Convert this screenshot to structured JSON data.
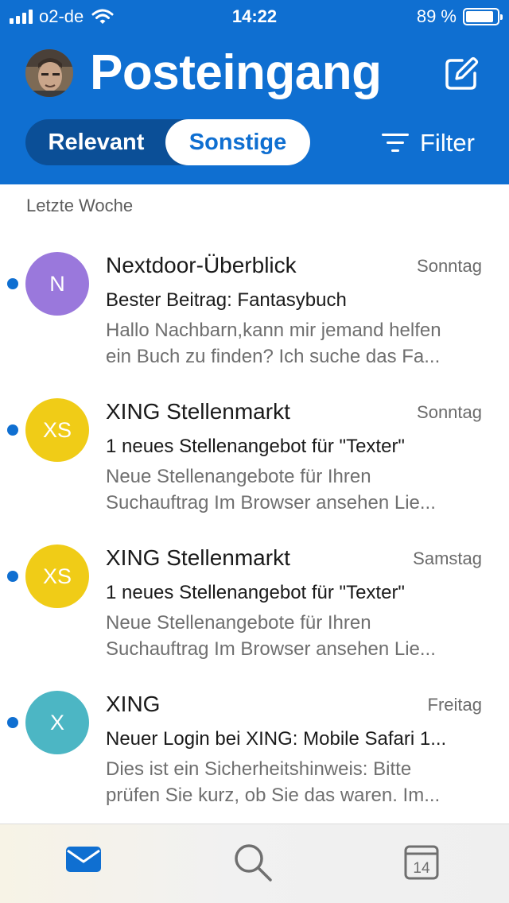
{
  "status_bar": {
    "carrier": "o2-de",
    "time": "14:22",
    "battery_percent": "89 %",
    "battery_level": 0.89
  },
  "header": {
    "title": "Posteingang",
    "compose_icon": "compose-icon",
    "avatar": "user-avatar-photo"
  },
  "tabs": {
    "relevant": "Relevant",
    "sonstige": "Sonstige",
    "selected": "Sonstige",
    "filter_label": "Filter"
  },
  "section_label": "Letzte Woche",
  "messages": [
    {
      "initials": "N",
      "avatar_color": "#9a78dc",
      "sender": "Nextdoor-Überblick",
      "date": "Sonntag",
      "subject": "Bester Beitrag: Fantasybuch",
      "preview_line1": "Hallo Nachbarn,kann mir jemand helfen",
      "preview_line2": "ein Buch zu finden? Ich suche das Fa...",
      "unread": true
    },
    {
      "initials": "XS",
      "avatar_color": "#f0cc17",
      "sender": "XING Stellenmarkt",
      "date": "Sonntag",
      "subject": "1 neues Stellenangebot für \"Texter\"",
      "preview_line1": "Neue Stellenangebote für Ihren",
      "preview_line2": "Suchauftrag Im Browser ansehen Lie...",
      "unread": true
    },
    {
      "initials": "XS",
      "avatar_color": "#f0cc17",
      "sender": "XING Stellenmarkt",
      "date": "Samstag",
      "subject": "1 neues Stellenangebot für \"Texter\"",
      "preview_line1": "Neue Stellenangebote für Ihren",
      "preview_line2": "Suchauftrag Im Browser ansehen Lie...",
      "unread": true
    },
    {
      "initials": "X",
      "avatar_color": "#4cb6c4",
      "sender": "XING",
      "date": "Freitag",
      "subject": "Neuer Login bei XING: Mobile Safari 1...",
      "preview_line1": "Dies ist ein Sicherheitshinweis: Bitte",
      "preview_line2": "prüfen Sie kurz, ob Sie das waren. Im...",
      "unread": true
    }
  ],
  "tab_bar": {
    "mail_icon": "mail-icon",
    "search_icon": "search-icon",
    "calendar_icon": "calendar-icon",
    "calendar_day": "14",
    "active": "mail"
  },
  "colors": {
    "brand_blue": "#0f6fd1",
    "segment_dark": "#0b4f97"
  }
}
